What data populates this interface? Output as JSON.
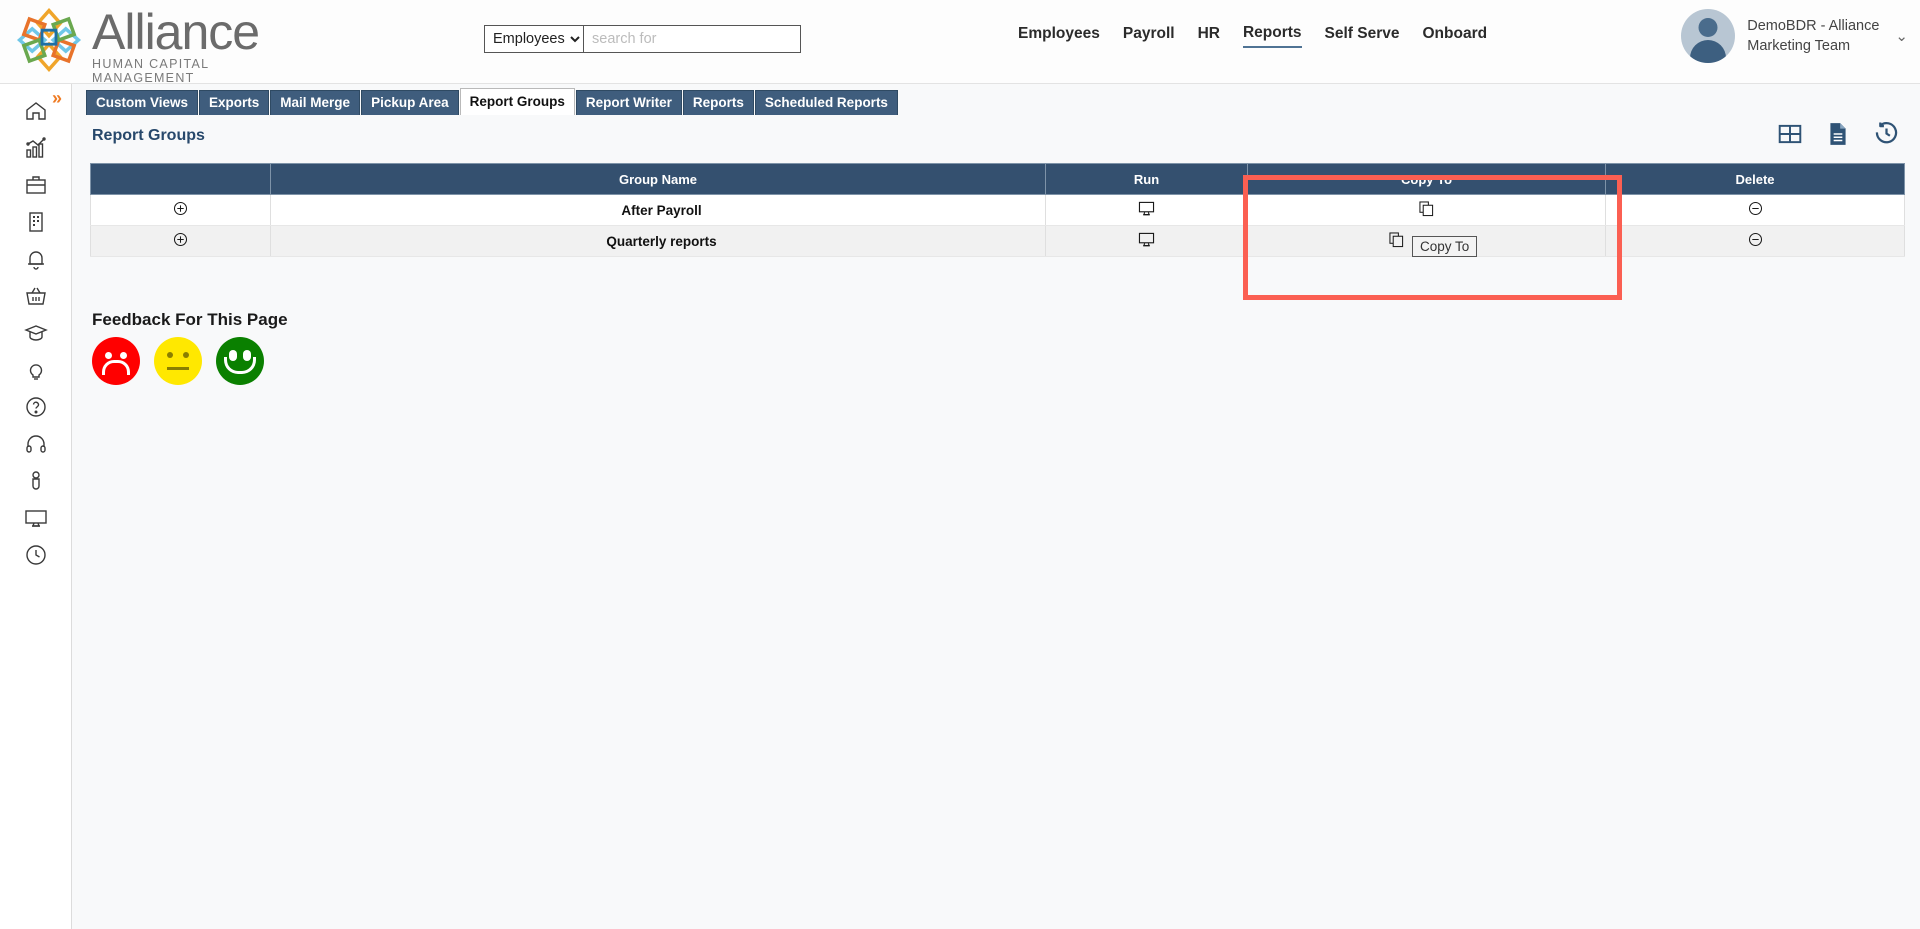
{
  "brand": {
    "name": "Alliance",
    "tagline": "HUMAN CAPITAL MANAGEMENT",
    "logo_icon": "alliance-star-logo"
  },
  "search": {
    "selected_scope": "Employees",
    "scope_options": [
      "Employees"
    ],
    "placeholder": "search for",
    "value": ""
  },
  "topnav": {
    "items": [
      {
        "label": "Employees",
        "active": false
      },
      {
        "label": "Payroll",
        "active": false
      },
      {
        "label": "HR",
        "active": false
      },
      {
        "label": "Reports",
        "active": true
      },
      {
        "label": "Self Serve",
        "active": false
      },
      {
        "label": "Onboard",
        "active": false
      }
    ]
  },
  "profile": {
    "name_line1": "DemoBDR - Alliance",
    "name_line2": "Marketing Team",
    "caret_icon": "chevron-down-icon",
    "avatar_icon": "user-avatar-icon"
  },
  "sidebar": {
    "expander_icon": "double-chevron-right-icon",
    "items": [
      {
        "icon": "home-icon",
        "name": "home"
      },
      {
        "icon": "analytics-chart-icon",
        "name": "analytics"
      },
      {
        "icon": "briefcase-icon",
        "name": "briefcase"
      },
      {
        "icon": "building-icon",
        "name": "company"
      },
      {
        "icon": "bell-icon",
        "name": "notifications"
      },
      {
        "icon": "basket-icon",
        "name": "marketplace"
      },
      {
        "icon": "graduation-cap-icon",
        "name": "learning"
      },
      {
        "icon": "lightbulb-icon",
        "name": "ideas"
      },
      {
        "icon": "question-circle-icon",
        "name": "help"
      },
      {
        "icon": "headset-icon",
        "name": "support"
      },
      {
        "icon": "person-icon",
        "name": "profile"
      },
      {
        "icon": "monitor-icon",
        "name": "desktop"
      },
      {
        "icon": "clock-icon",
        "name": "time"
      }
    ]
  },
  "tabs": [
    {
      "label": "Custom Views",
      "active": false
    },
    {
      "label": "Exports",
      "active": false
    },
    {
      "label": "Mail Merge",
      "active": false
    },
    {
      "label": "Pickup Area",
      "active": false
    },
    {
      "label": "Report Groups",
      "active": true
    },
    {
      "label": "Report Writer",
      "active": false
    },
    {
      "label": "Reports",
      "active": false
    },
    {
      "label": "Scheduled Reports",
      "active": false
    }
  ],
  "page": {
    "title": "Report Groups"
  },
  "toolbar": {
    "icons": [
      {
        "icon": "grid-table-icon",
        "name": "grid-view"
      },
      {
        "icon": "document-icon",
        "name": "document-export"
      },
      {
        "icon": "history-clock-icon",
        "name": "history"
      }
    ]
  },
  "table": {
    "columns": [
      {
        "label": ""
      },
      {
        "label": "Group Name"
      },
      {
        "label": "Run"
      },
      {
        "label": "Copy To"
      },
      {
        "label": "Delete"
      }
    ],
    "rows": [
      {
        "expand_icon": "plus-circle-icon",
        "group_name": "After Payroll",
        "run_icon": "monitor-run-icon",
        "copy_icon": "copy-pages-icon",
        "delete_icon": "minus-circle-icon"
      },
      {
        "expand_icon": "plus-circle-icon",
        "group_name": "Quarterly reports",
        "run_icon": "monitor-run-icon",
        "copy_icon": "copy-pages-icon",
        "delete_icon": "minus-circle-icon"
      }
    ]
  },
  "tooltip": {
    "text": "Copy To"
  },
  "annotation": {
    "color": "#fb5f52",
    "target": "copy-to-column"
  },
  "feedback": {
    "title": "Feedback For This Page",
    "options": [
      {
        "name": "sad-face",
        "color": "#ff0000"
      },
      {
        "name": "neutral-face",
        "color": "#ffe800"
      },
      {
        "name": "happy-face",
        "color": "#0a8000"
      }
    ]
  },
  "colors": {
    "table_header": "#34506f",
    "tab_inactive": "#3f5d7d",
    "title": "#27486b",
    "accent_orange": "#ef7b23"
  }
}
